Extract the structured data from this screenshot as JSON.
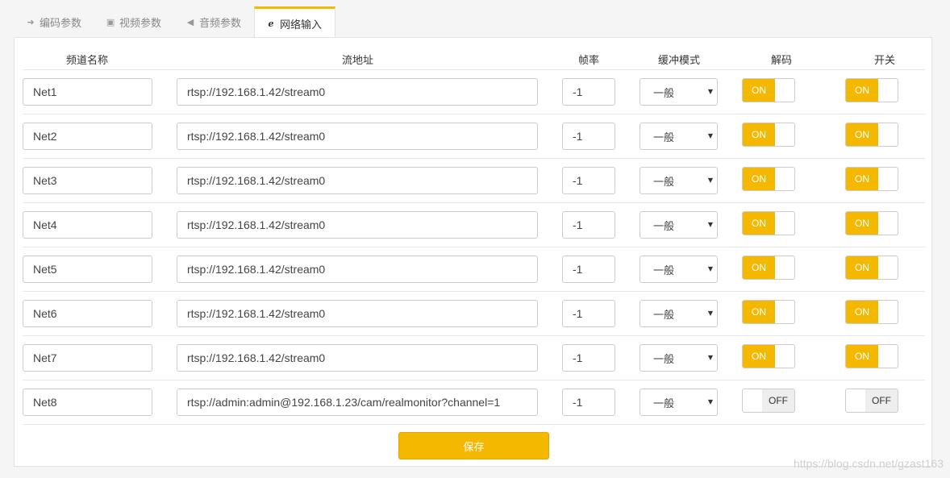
{
  "tabs": [
    {
      "label": "编码参数",
      "icon": "sign-in-icon",
      "glyph": "➜",
      "active": false
    },
    {
      "label": "视频参数",
      "icon": "image-icon",
      "glyph": "▣",
      "active": false
    },
    {
      "label": "音频参数",
      "icon": "volume-icon",
      "glyph": "◀",
      "active": false
    },
    {
      "label": "网络输入",
      "icon": "ie-icon",
      "glyph": "e",
      "active": true
    }
  ],
  "columns": {
    "name": "频道名称",
    "url": "流地址",
    "fps": "帧率",
    "buffer": "缓冲模式",
    "decode": "解码",
    "switch": "开关"
  },
  "rows": [
    {
      "name": "Net1",
      "url": "rtsp://192.168.1.42/stream0",
      "fps": "-1",
      "buffer": "一般",
      "decode": "ON",
      "switch": "ON"
    },
    {
      "name": "Net2",
      "url": "rtsp://192.168.1.42/stream0",
      "fps": "-1",
      "buffer": "一般",
      "decode": "ON",
      "switch": "ON"
    },
    {
      "name": "Net3",
      "url": "rtsp://192.168.1.42/stream0",
      "fps": "-1",
      "buffer": "一般",
      "decode": "ON",
      "switch": "ON"
    },
    {
      "name": "Net4",
      "url": "rtsp://192.168.1.42/stream0",
      "fps": "-1",
      "buffer": "一般",
      "decode": "ON",
      "switch": "ON"
    },
    {
      "name": "Net5",
      "url": "rtsp://192.168.1.42/stream0",
      "fps": "-1",
      "buffer": "一般",
      "decode": "ON",
      "switch": "ON"
    },
    {
      "name": "Net6",
      "url": "rtsp://192.168.1.42/stream0",
      "fps": "-1",
      "buffer": "一般",
      "decode": "ON",
      "switch": "ON"
    },
    {
      "name": "Net7",
      "url": "rtsp://192.168.1.42/stream0",
      "fps": "-1",
      "buffer": "一般",
      "decode": "ON",
      "switch": "ON"
    },
    {
      "name": "Net8",
      "url": "rtsp://admin:admin@192.168.1.23/cam/realmonitor?channel=1",
      "fps": "-1",
      "buffer": "一般",
      "decode": "OFF",
      "switch": "OFF"
    }
  ],
  "save_label": "保存",
  "watermark": "https://blog.csdn.net/gzast163",
  "colors": {
    "accent": "#f5b800"
  }
}
